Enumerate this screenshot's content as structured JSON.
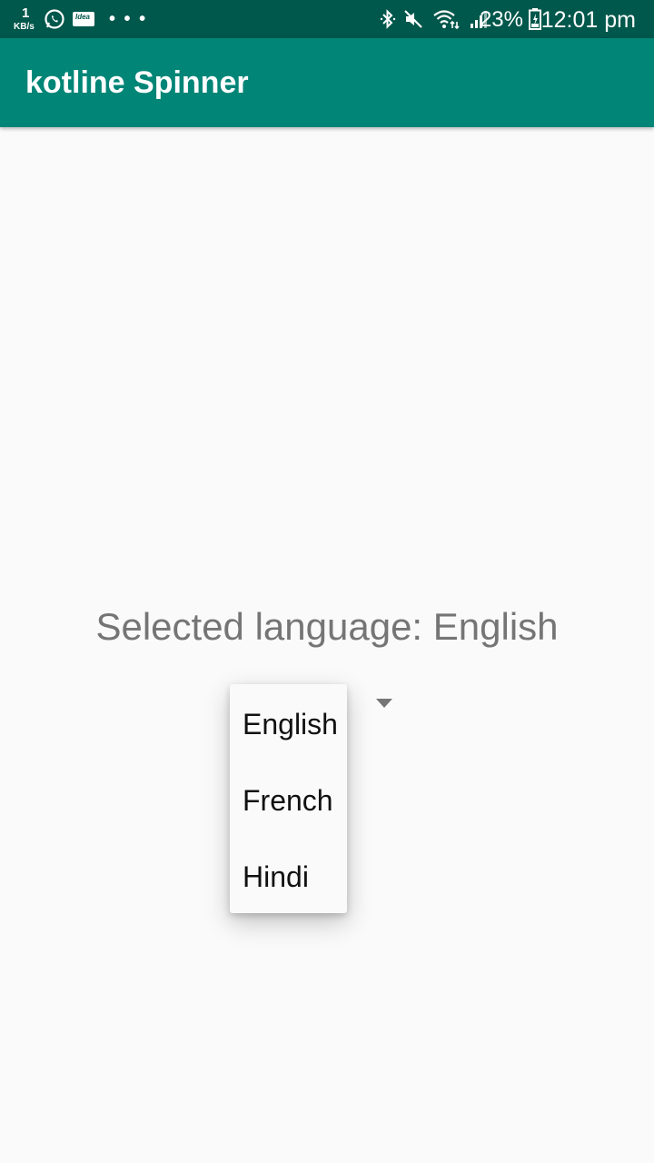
{
  "status_bar": {
    "net_speed_value": "1",
    "net_speed_unit": "KB/s",
    "idea_label": "Idea",
    "battery_percent": "23%",
    "time": "12:01 pm",
    "icons": [
      "network-speed-icon",
      "whatsapp-icon",
      "idea-icon",
      "more-dots-icon",
      "bluetooth-icon",
      "mute-icon",
      "wifi-icon",
      "signal-icon",
      "battery-icon"
    ]
  },
  "app_bar": {
    "title": "kotline Spinner",
    "color": "#008577"
  },
  "main": {
    "selected_label": "Selected language: English"
  },
  "spinner": {
    "selected": "English",
    "options": [
      "English",
      "French",
      "Hindi"
    ]
  },
  "colors": {
    "status_bar": "#00574b",
    "app_bar": "#008577",
    "background": "#fafafa",
    "secondary_text": "#757575"
  }
}
